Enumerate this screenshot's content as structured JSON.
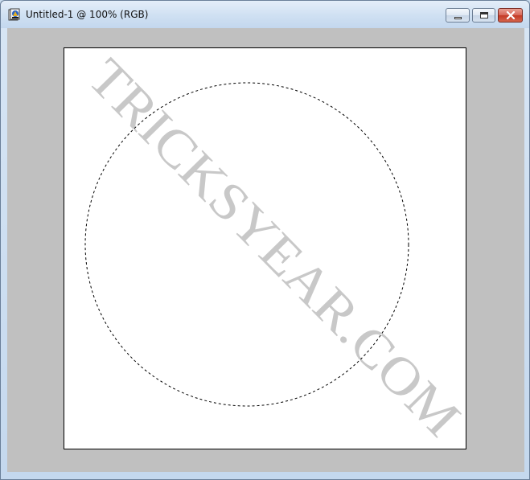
{
  "window": {
    "title": "Untitled-1 @ 100% (RGB)",
    "icon": "photoshop-doc-icon",
    "controls": {
      "minimize": "minimize-icon",
      "maximize": "maximize-icon",
      "close": "close-icon"
    }
  },
  "canvas": {
    "background_color": "#c0c0c0",
    "document_color": "#ffffff",
    "selection_shape": "elliptical-marquee",
    "watermark_text": "TRICKSYEAR.COM",
    "watermark_color": "#c8c8c8"
  }
}
